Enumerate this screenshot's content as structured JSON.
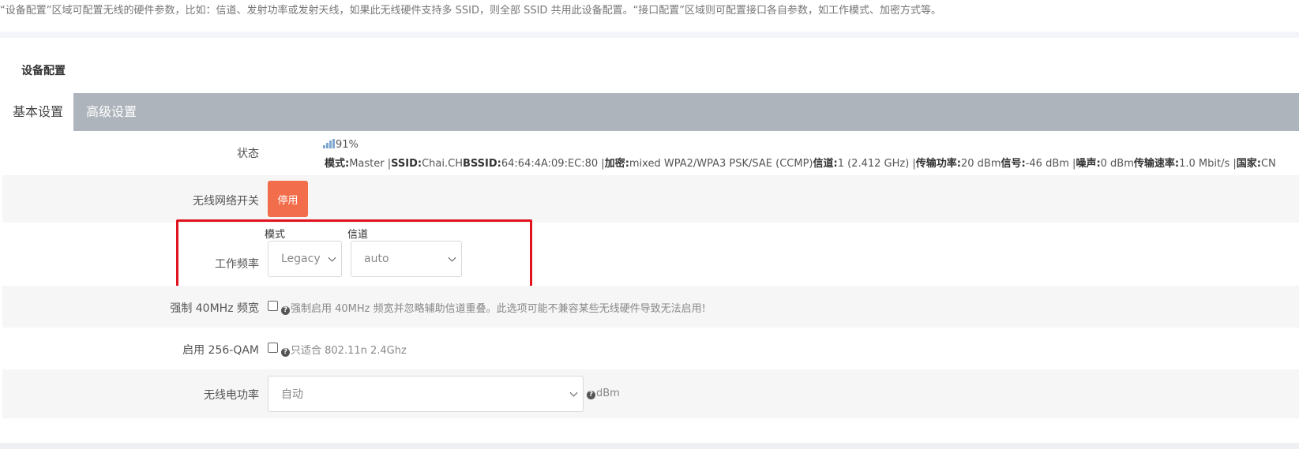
{
  "intro_text": "“设备配置”区域可配置无线的硬件参数，比如：信道、发射功率或发射天线，如果此无线硬件支持多 SSID，则全部 SSID 共用此设备配置。“接口配置”区域则可配置接口各自参数，如工作模式、加密方式等。",
  "section_title": "设备配置",
  "tabs": [
    {
      "label": "基本设置"
    },
    {
      "label": "高级设置"
    }
  ],
  "status": {
    "label": "状态",
    "signal_percent": "91%",
    "mode_key": "模式:",
    "mode_val": "Master |",
    "ssid_key": "SSID:",
    "ssid_val": "Chai.CH",
    "bssid_key": "BSSID:",
    "bssid_val": "64:64:4A:09:EC:80 |",
    "enc_key": "加密:",
    "enc_val": "mixed WPA2/WPA3 PSK/SAE (CCMP)",
    "chan_key": "信道:",
    "chan_val": "1 (2.412 GHz) |",
    "txpower_key": "传输功率:",
    "txpower_val": "20 dBm",
    "signal_key": "信号:",
    "signal_val": "-46 dBm |",
    "noise_key": "噪声:",
    "noise_val": "0 dBm",
    "rate_key": "传输速率:",
    "rate_val": "1.0 Mbit/s |",
    "country_key": "国家:",
    "country_val": "CN"
  },
  "wireless_switch": {
    "label": "无线网络开关",
    "button": "停用"
  },
  "frequency": {
    "label": "工作频率",
    "mode_label": "模式",
    "mode_value": "Legacy",
    "channel_label": "信道",
    "channel_value": "auto"
  },
  "force40": {
    "label": "强制 40MHz 频宽",
    "hint": "强制启用 40MHz 频宽并忽略辅助信道重叠。此选项可能不兼容某些无线硬件导致无法启用!"
  },
  "qam256": {
    "label": "启用 256-QAM",
    "hint": "只适合 802.11n 2.4Ghz"
  },
  "txpower": {
    "label": "无线电功率",
    "value": "自动",
    "unit": "dBm"
  },
  "colors": {
    "accent_button": "#f26d4b",
    "tabbar": "#aeb4bb",
    "highlight_box": "#e0131f"
  }
}
